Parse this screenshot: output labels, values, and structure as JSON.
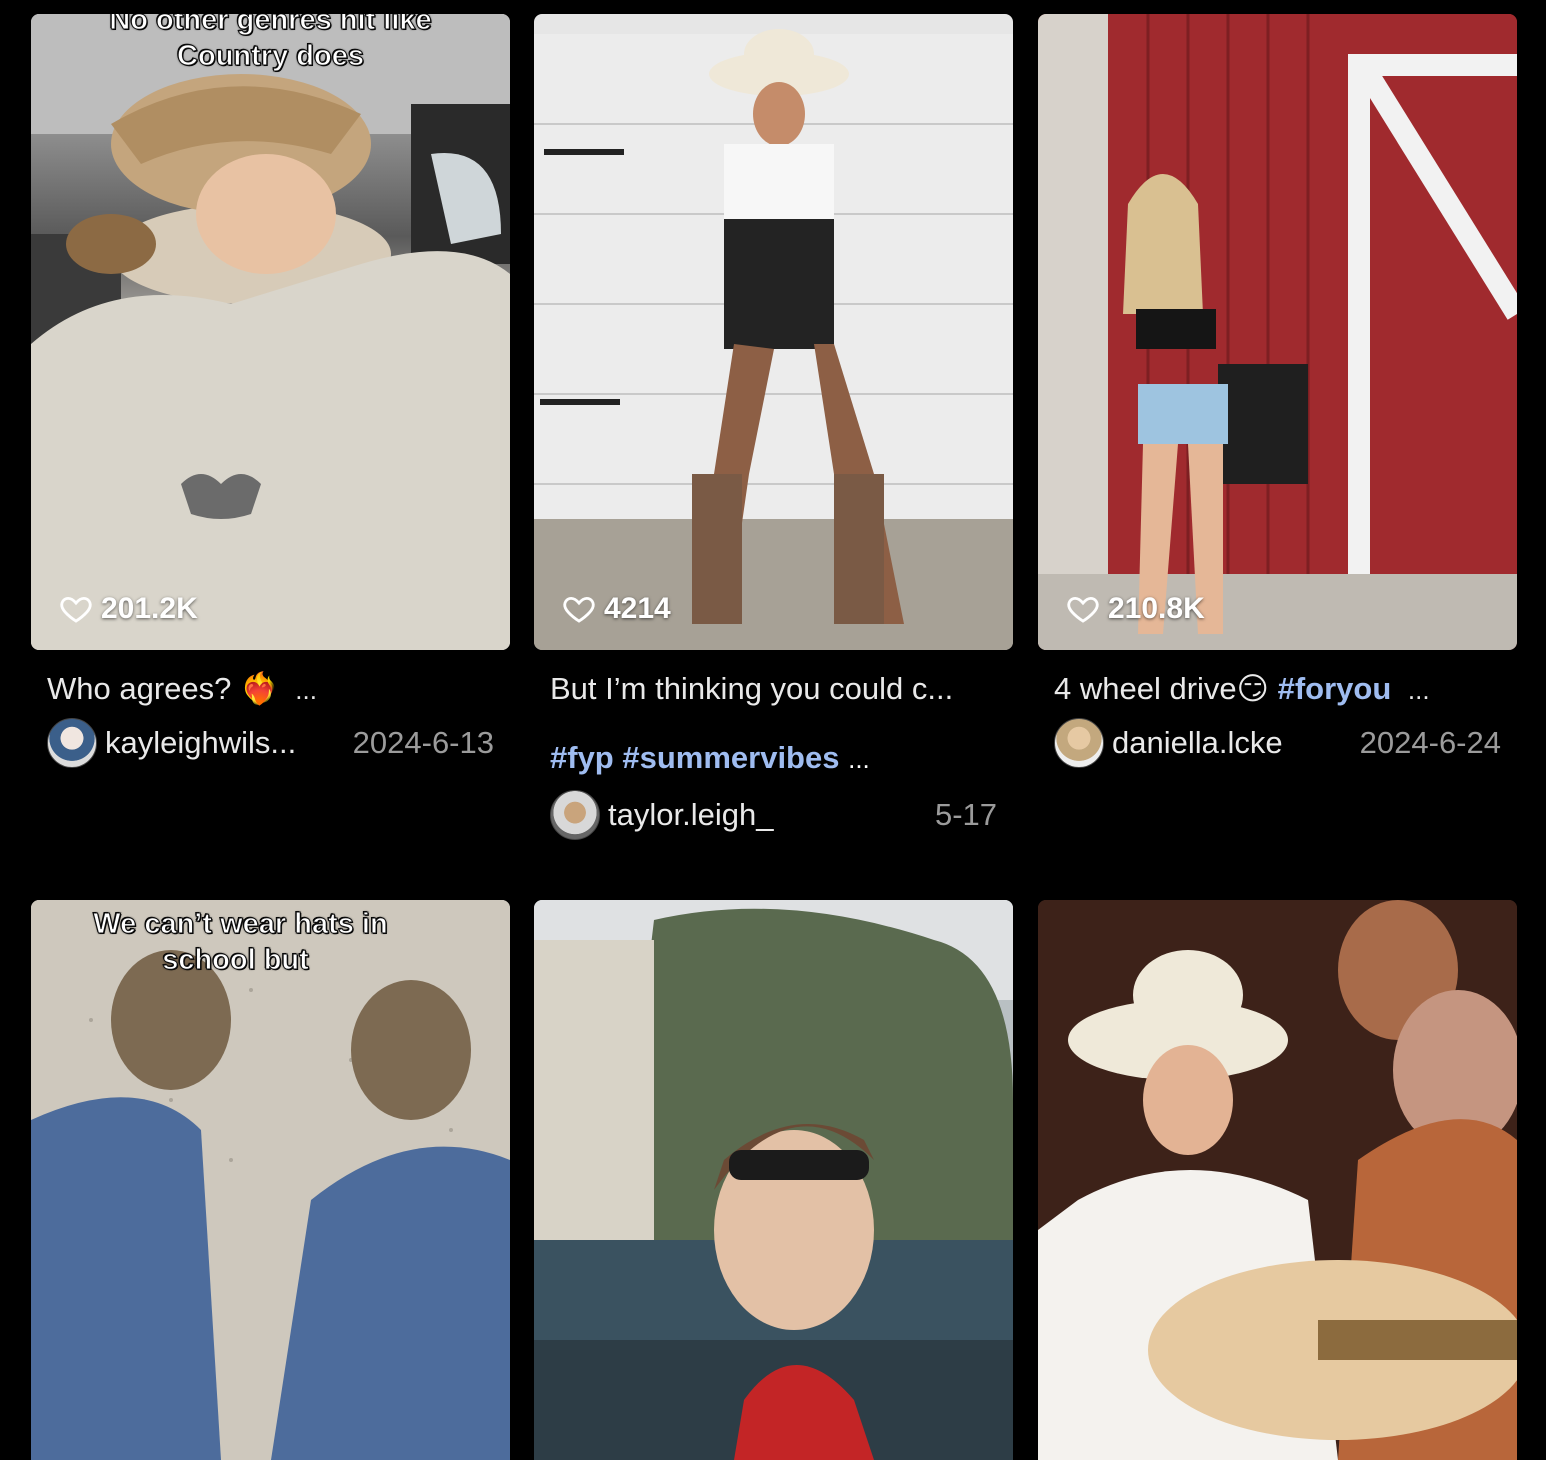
{
  "cards": [
    {
      "overlay_lines": [
        "No other genres hit like",
        "Country does"
      ],
      "likes": "201.2K",
      "caption": "Who agrees?",
      "caption_emoji": "❤️‍🔥",
      "caption_more": "...",
      "username": "kayleighwils...",
      "date": "2024-6-13",
      "icon": "heart-icon"
    },
    {
      "likes": "4214",
      "caption": "But I’m thinking you could c...",
      "hashtags": "#fyp #summervibes",
      "caption_more": "...",
      "username": "taylor.leigh_",
      "date": "5-17",
      "icon": "heart-icon"
    },
    {
      "likes": "210.8K",
      "caption": "4 wheel drive",
      "caption_emoji": "😏",
      "hashtag": "#foryou",
      "caption_more": "...",
      "username": "daniella.lcke",
      "date": "2024-6-24",
      "icon": "heart-icon"
    },
    {
      "overlay_lines": [
        "We can’t wear hats in",
        "school but"
      ]
    },
    {},
    {}
  ],
  "colors": {
    "background": "#000000",
    "hashtag": "#9fbcf0",
    "date": "#9b9b9b"
  }
}
